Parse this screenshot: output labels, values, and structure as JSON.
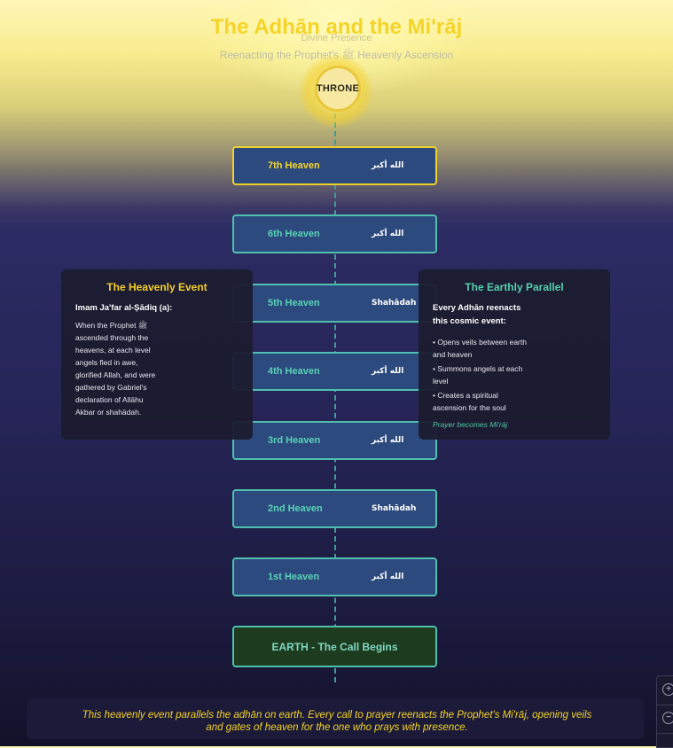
{
  "header": {
    "title": "The Adhān and the Mi'rāj",
    "divine_label": "Divine Presence",
    "subtitle": "Reenacting the Prophet's ﷺ Heavenly Ascension"
  },
  "throne": {
    "label": "THRONE"
  },
  "levels": [
    {
      "name": "7th Heaven",
      "call": "الله أكبر"
    },
    {
      "name": "6th Heaven",
      "call": "الله أكبر"
    },
    {
      "name": "5th Heaven",
      "call": "Shahādah"
    },
    {
      "name": "4th Heaven",
      "call": "الله أكبر"
    },
    {
      "name": "3rd Heaven",
      "call": "الله أكبر"
    },
    {
      "name": "2nd Heaven",
      "call": "Shahādah"
    },
    {
      "name": "1st Heaven",
      "call": "الله أكبر"
    }
  ],
  "earth": {
    "label": "EARTH - The Call Begins"
  },
  "left_panel": {
    "title": "The Heavenly Event",
    "heading": "Imam Ja'far al-Ṣādiq (a):",
    "body": "When the Prophet ﷺ ascended through the heavens, at each level angels fled in awe, glorified Allah, and were gathered by Gabriel's declaration of Allāhu Akbar or shahādah."
  },
  "right_panel": {
    "title": "The Earthly Parallel",
    "heading": "Every Adhān reenacts this cosmic event:",
    "bullets": [
      "• Opens veils between earth and heaven",
      "• Summons angels at each level",
      "• Creates a spiritual ascension for the soul"
    ],
    "footer": "Prayer becomes Mi'rāj"
  },
  "footer": {
    "text": "This heavenly event parallels the adhān on earth. Every call to prayer reenacts the Prophet's Mi'rāj, opening veils and gates of heaven for the one who prays with presence."
  },
  "zoom": {
    "in_icon": "zoom-in-icon",
    "out_icon": "zoom-out-icon"
  },
  "colors": {
    "gold": "#f5d42a",
    "teal": "#4ec0ad",
    "level_fill": "#2d4a7e",
    "earth_fill": "#1d3b1e"
  }
}
